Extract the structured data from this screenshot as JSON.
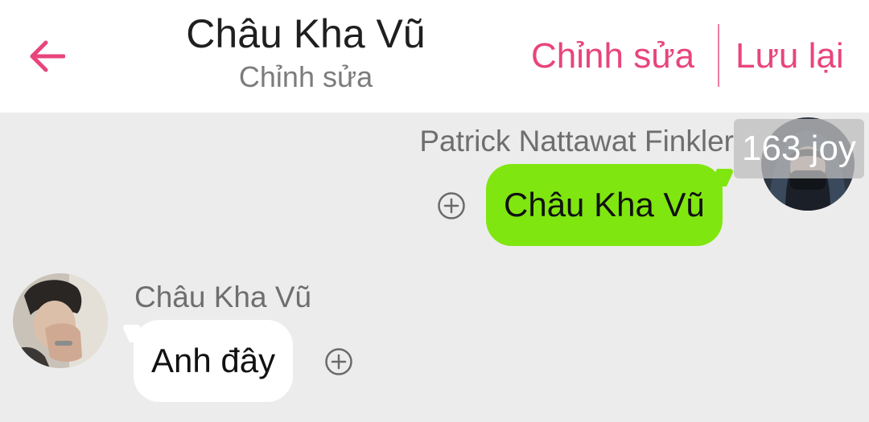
{
  "header": {
    "title": "Châu Kha Vũ",
    "subtitle": "Chỉnh sửa",
    "edit_label": "Chỉnh sửa",
    "save_label": "Lưu lại",
    "back_icon": "arrow-left-icon",
    "accent_color": "#e8457c"
  },
  "messages": [
    {
      "side": "right",
      "sender": "Patrick Nattawat Finkler",
      "text": "Châu Kha Vũ",
      "bubble_color": "#80e60f",
      "add_icon": "plus-circle-icon"
    },
    {
      "side": "left",
      "sender": "Châu Kha Vũ",
      "text": "Anh đây",
      "bubble_color": "#ffffff",
      "add_icon": "plus-circle-icon"
    }
  ],
  "watermark": {
    "text": "163 joy"
  }
}
